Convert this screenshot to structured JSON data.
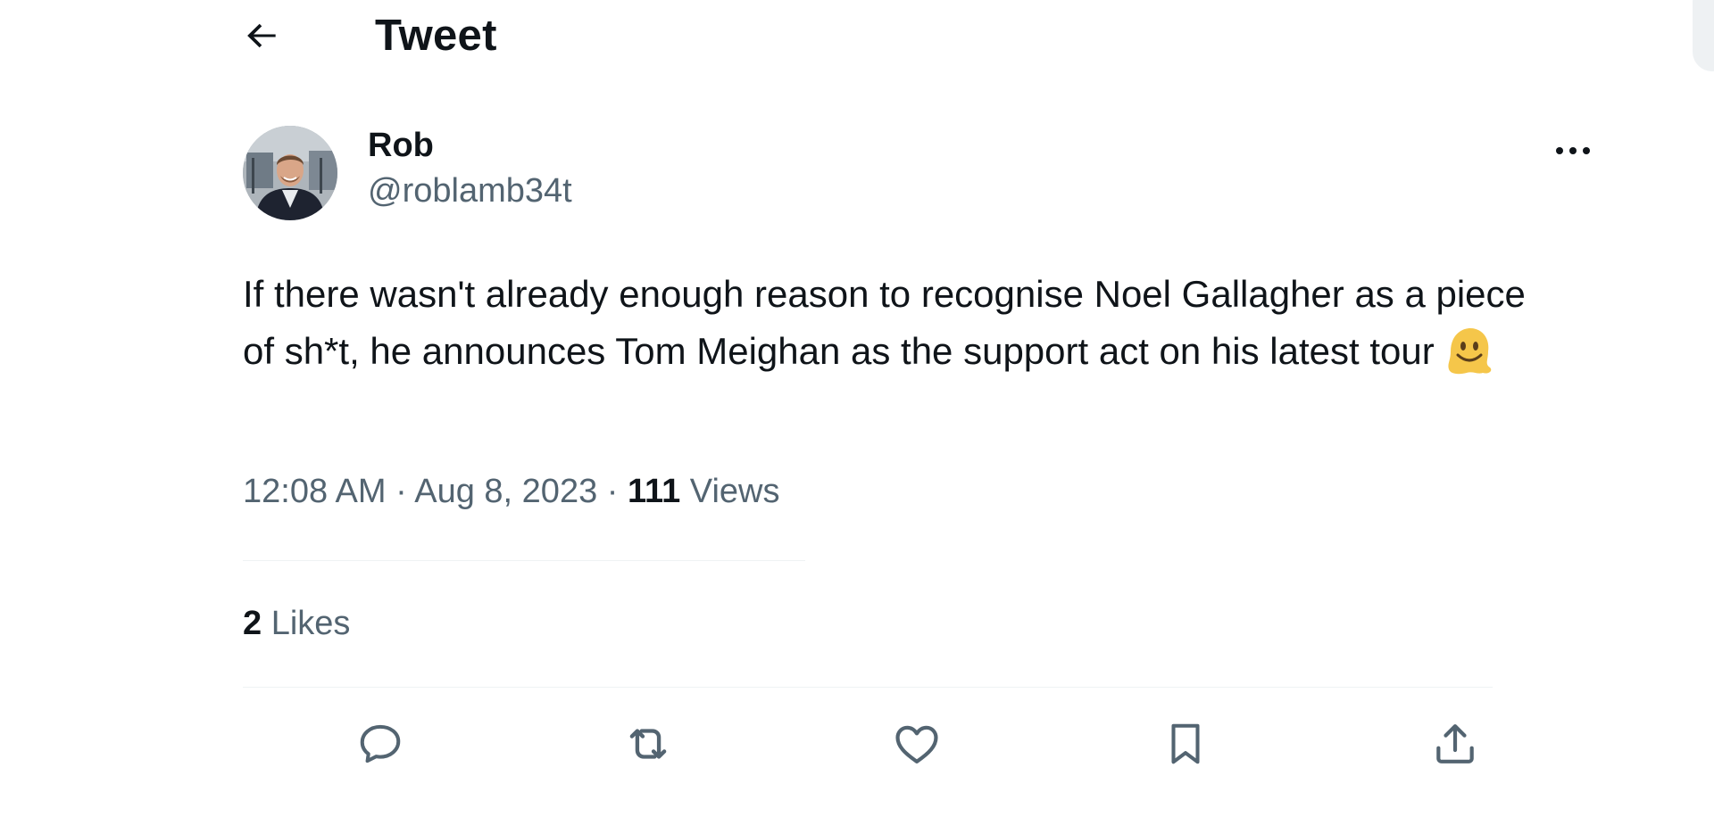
{
  "header": {
    "back_icon": "arrow-left-icon",
    "title": "Tweet"
  },
  "tweet": {
    "author": {
      "name": "Rob",
      "handle": "@roblamb34t",
      "avatar": "profile-photo"
    },
    "more_icon": "more-horizontal-icon",
    "text": "If there wasn't already enough reason to recognise Noel Gallagher as a piece of sh*t, he announces Tom Meighan as the support act on his latest tour",
    "emoji": "melting-face-emoji",
    "time": "12:08 AM",
    "separator": "·",
    "date": "Aug 8, 2023",
    "views_count": "111",
    "views_label": "Views",
    "likes_count": "2",
    "likes_label": "Likes"
  },
  "actions": [
    {
      "name": "reply",
      "icon": "reply-icon"
    },
    {
      "name": "retweet",
      "icon": "retweet-icon"
    },
    {
      "name": "like",
      "icon": "heart-icon"
    },
    {
      "name": "bookmark",
      "icon": "bookmark-icon"
    },
    {
      "name": "share",
      "icon": "share-icon"
    }
  ],
  "colors": {
    "text_primary": "#0f1419",
    "text_secondary": "#536471",
    "icon": "#536471",
    "divider": "#eff3f4",
    "emoji": "#f5c64a"
  }
}
